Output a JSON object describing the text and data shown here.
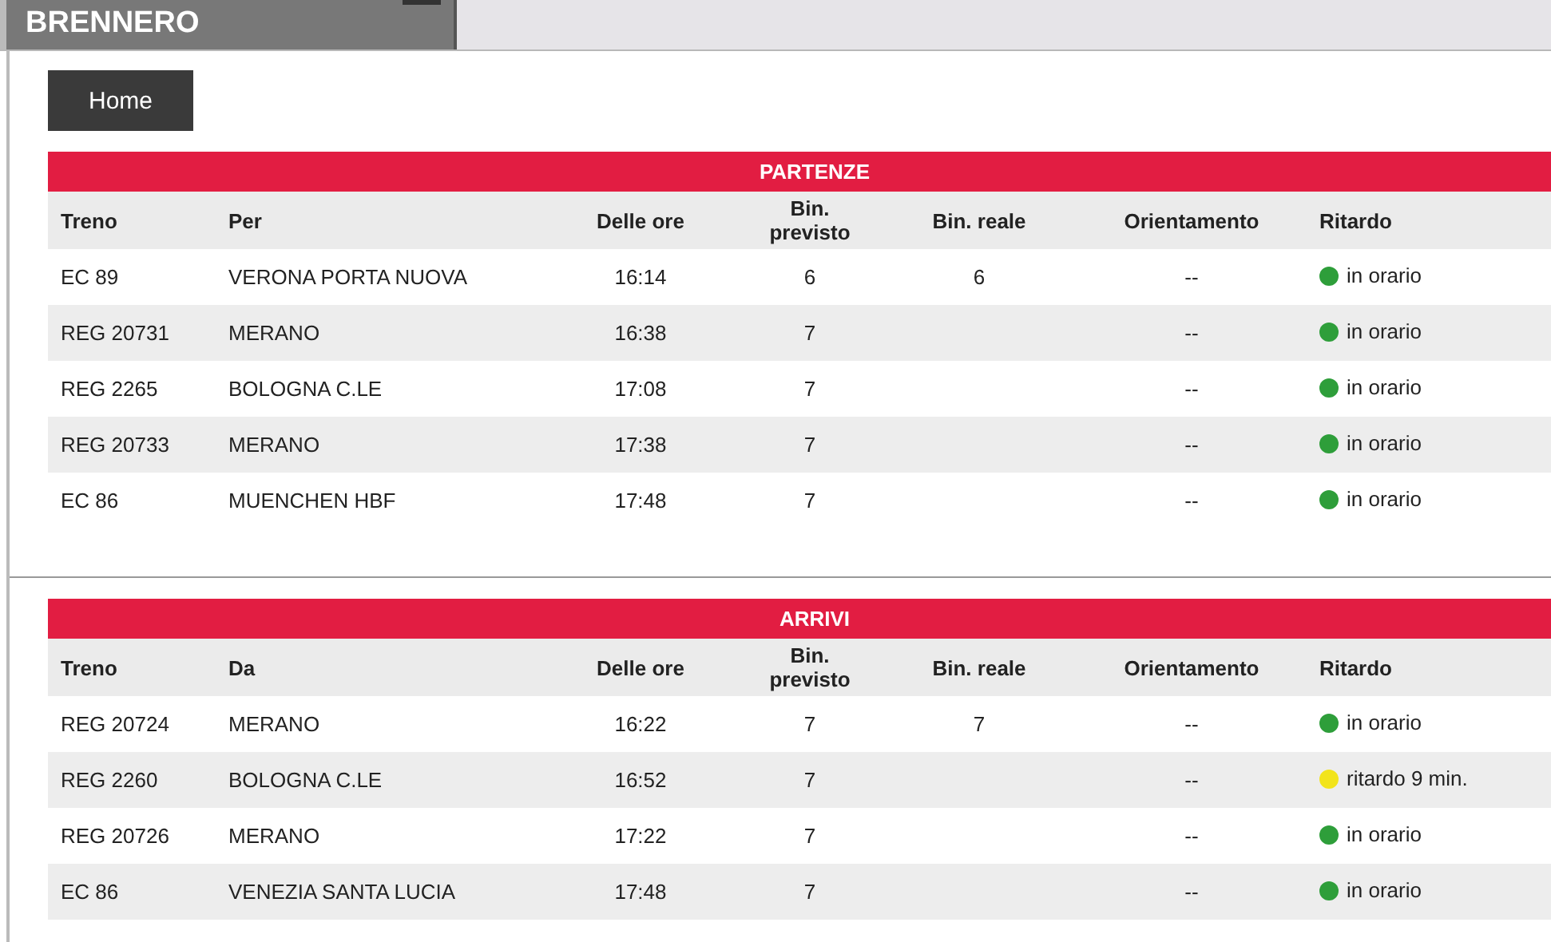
{
  "station": "BRENNERO",
  "nav": [
    {
      "label": "Home"
    }
  ],
  "boards": [
    {
      "title": "PARTENZE",
      "columns": [
        "Treno",
        "Per",
        "Delle ore",
        "Bin. previsto",
        "Bin. reale",
        "Orientamento",
        "Ritardo"
      ],
      "rows": [
        {
          "train": "EC 89",
          "place": "VERONA PORTA NUOVA",
          "time": "16:14",
          "planned": "6",
          "actual": "6",
          "orientation": "--",
          "status": "in orario",
          "color": "#2e9e3a"
        },
        {
          "train": "REG 20731",
          "place": "MERANO",
          "time": "16:38",
          "planned": "7",
          "actual": "",
          "orientation": "--",
          "status": "in orario",
          "color": "#2e9e3a"
        },
        {
          "train": "REG 2265",
          "place": "BOLOGNA C.LE",
          "time": "17:08",
          "planned": "7",
          "actual": "",
          "orientation": "--",
          "status": "in orario",
          "color": "#2e9e3a"
        },
        {
          "train": "REG 20733",
          "place": "MERANO",
          "time": "17:38",
          "planned": "7",
          "actual": "",
          "orientation": "--",
          "status": "in orario",
          "color": "#2e9e3a"
        },
        {
          "train": "EC 86",
          "place": "MUENCHEN HBF",
          "time": "17:48",
          "planned": "7",
          "actual": "",
          "orientation": "--",
          "status": "in orario",
          "color": "#2e9e3a"
        }
      ]
    },
    {
      "title": "ARRIVI",
      "columns": [
        "Treno",
        "Da",
        "Delle ore",
        "Bin. previsto",
        "Bin. reale",
        "Orientamento",
        "Ritardo"
      ],
      "rows": [
        {
          "train": "REG 20724",
          "place": "MERANO",
          "time": "16:22",
          "planned": "7",
          "actual": "7",
          "orientation": "--",
          "status": "in orario",
          "color": "#2e9e3a"
        },
        {
          "train": "REG 2260",
          "place": "BOLOGNA C.LE",
          "time": "16:52",
          "planned": "7",
          "actual": "",
          "orientation": "--",
          "status": "ritardo 9 min.",
          "color": "#f2e41c"
        },
        {
          "train": "REG 20726",
          "place": "MERANO",
          "time": "17:22",
          "planned": "7",
          "actual": "",
          "orientation": "--",
          "status": "in orario",
          "color": "#2e9e3a"
        },
        {
          "train": "EC 86",
          "place": "VENEZIA SANTA LUCIA",
          "time": "17:48",
          "planned": "7",
          "actual": "",
          "orientation": "--",
          "status": "in orario",
          "color": "#2e9e3a"
        }
      ]
    }
  ]
}
